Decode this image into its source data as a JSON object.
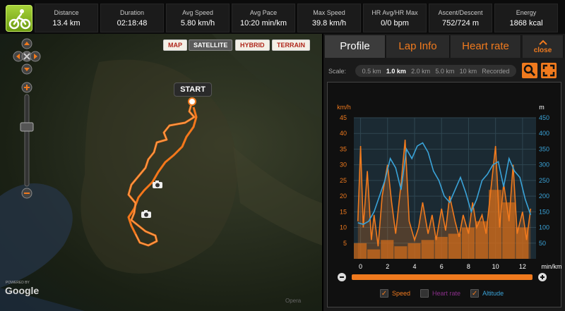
{
  "stats": [
    {
      "label": "Distance",
      "value": "13.4 km"
    },
    {
      "label": "Duration",
      "value": "02:18:48"
    },
    {
      "label": "Avg Speed",
      "value": "5.80 km/h"
    },
    {
      "label": "Avg Pace",
      "value": "10:20 min/km"
    },
    {
      "label": "Max Speed",
      "value": "39.8 km/h"
    },
    {
      "label": "HR Avg/HR Max",
      "value": "0/0 bpm"
    },
    {
      "label": "Ascent/Descent",
      "value": "752/724 m"
    },
    {
      "label": "Energy",
      "value": "1868 kcal"
    }
  ],
  "map": {
    "types": [
      "MAP",
      "SATELLITE",
      "HYBRID",
      "TERRAIN"
    ],
    "active_type": "SATELLITE",
    "start_label": "START",
    "powered_by": "POWERED BY",
    "google": "Google",
    "copyright": "Opera"
  },
  "tabs": [
    "Profile",
    "Lap Info",
    "Heart rate",
    "close"
  ],
  "active_tab": "Profile",
  "scale": {
    "label": "Scale:",
    "options": [
      "0.5 km",
      "1.0 km",
      "2.0 km",
      "5.0 km",
      "10 km",
      "Recorded"
    ],
    "selected": "1.0 km"
  },
  "legend": [
    {
      "label": "Speed",
      "checked": true,
      "color": "#f07a1e"
    },
    {
      "label": "Heart rate",
      "checked": false,
      "color": "#8a2f8a"
    },
    {
      "label": "Altitude",
      "checked": true,
      "color": "#3aa3d8"
    }
  ],
  "chart_data": {
    "type": "line",
    "left_axis_unit": "km/h",
    "right_axis_unit": "m",
    "x_unit": "min/km",
    "xlim": [
      -0.5,
      13
    ],
    "speed_ylim": [
      0,
      45
    ],
    "alt_ylim": [
      0,
      450
    ],
    "x_ticks": [
      0,
      2,
      4,
      6,
      8,
      10,
      12
    ],
    "speed_ticks": [
      5,
      10,
      15,
      20,
      25,
      30,
      35,
      40,
      45
    ],
    "alt_ticks": [
      50,
      100,
      150,
      200,
      250,
      300,
      350,
      400,
      450
    ],
    "speed_bar_km": [
      0,
      1,
      2,
      3,
      4,
      5,
      6,
      7,
      8,
      9,
      10,
      11,
      12
    ],
    "speed_bar_values": [
      5,
      3,
      6,
      4,
      5,
      6,
      7,
      8,
      10,
      12,
      22,
      18,
      10
    ],
    "speed_x": [
      -0.2,
      0,
      0.2,
      0.5,
      0.8,
      1.0,
      1.3,
      1.6,
      2.0,
      2.3,
      2.6,
      3.0,
      3.3,
      3.6,
      4.0,
      4.3,
      4.6,
      5.0,
      5.3,
      5.6,
      6.0,
      6.3,
      6.6,
      7.0,
      7.3,
      7.6,
      8.0,
      8.3,
      8.6,
      9.0,
      9.3,
      9.6,
      10.0,
      10.3,
      10.6,
      11.0,
      11.3,
      11.6,
      12.0,
      12.3,
      12.6
    ],
    "speed_values": [
      12,
      36,
      10,
      28,
      6,
      14,
      4,
      20,
      30,
      18,
      8,
      24,
      38,
      12,
      6,
      10,
      18,
      8,
      14,
      6,
      16,
      9,
      20,
      12,
      7,
      14,
      8,
      18,
      10,
      14,
      8,
      20,
      36,
      10,
      24,
      12,
      30,
      8,
      15,
      6,
      16
    ],
    "alt_x": [
      -0.2,
      0.2,
      0.6,
      1.0,
      1.4,
      1.8,
      2.2,
      2.6,
      3.0,
      3.4,
      3.8,
      4.2,
      4.6,
      5.0,
      5.4,
      5.8,
      6.2,
      6.6,
      7.0,
      7.4,
      7.8,
      8.2,
      8.6,
      9.0,
      9.4,
      9.8,
      10.2,
      10.6,
      11.0,
      11.4,
      11.8,
      12.2,
      12.6
    ],
    "alt_values": [
      115,
      110,
      120,
      150,
      200,
      250,
      320,
      290,
      220,
      350,
      320,
      360,
      370,
      340,
      280,
      250,
      200,
      180,
      220,
      260,
      210,
      150,
      190,
      250,
      270,
      300,
      310,
      230,
      320,
      280,
      260,
      190,
      140
    ]
  }
}
